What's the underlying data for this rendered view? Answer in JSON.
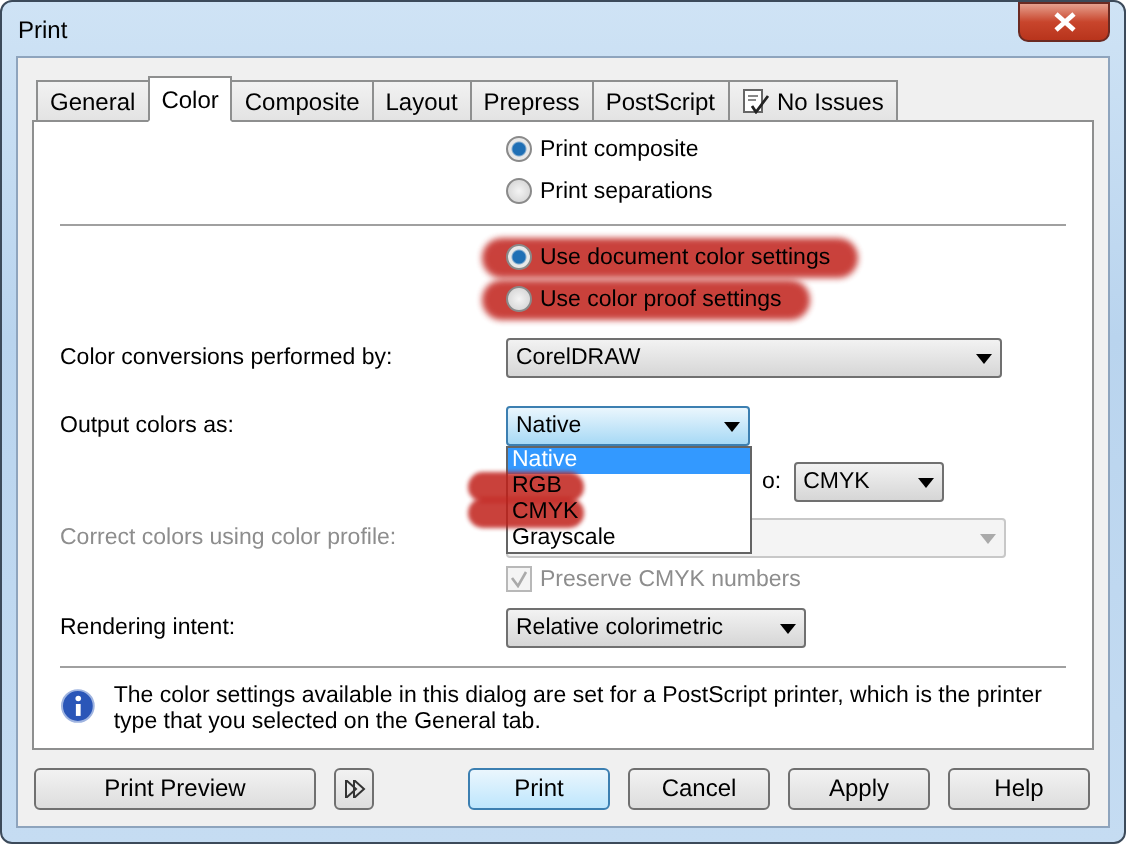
{
  "window": {
    "title": "Print"
  },
  "tabs": [
    {
      "label": "General",
      "selected": false,
      "kind": "plain"
    },
    {
      "label": "Color",
      "selected": true,
      "kind": "plain"
    },
    {
      "label": "Composite",
      "selected": false,
      "kind": "plain"
    },
    {
      "label": "Layout",
      "selected": false,
      "kind": "plain"
    },
    {
      "label": "Prepress",
      "selected": false,
      "kind": "plain"
    },
    {
      "label": "PostScript",
      "selected": false,
      "kind": "plain"
    },
    {
      "label": "No Issues",
      "selected": false,
      "kind": "status"
    }
  ],
  "print_mode": [
    {
      "label": "Print composite",
      "selected": true,
      "highlighted": false
    },
    {
      "label": "Print separations",
      "selected": false,
      "highlighted": false
    }
  ],
  "color_settings": [
    {
      "label": "Use document color settings",
      "selected": true,
      "highlighted": true
    },
    {
      "label": "Use color proof settings",
      "selected": false,
      "highlighted": true
    }
  ],
  "conversions": {
    "label": "Color conversions performed by:",
    "value": "CorelDRAW"
  },
  "output_colors": {
    "label": "Output colors as:",
    "value": "Native",
    "options": [
      {
        "label": "Native",
        "selected": true,
        "highlighted": false
      },
      {
        "label": "RGB",
        "selected": false,
        "highlighted": true
      },
      {
        "label": "CMYK",
        "selected": false,
        "highlighted": true
      },
      {
        "label": "Grayscale",
        "selected": false,
        "highlighted": false
      }
    ]
  },
  "convert_to": {
    "label": "o:",
    "value": "CMYK"
  },
  "profile": {
    "label": "Correct colors using color profile:",
    "disabled": true
  },
  "preserve": {
    "label": "Preserve CMYK numbers",
    "checked": true,
    "disabled": true
  },
  "rendering": {
    "label": "Rendering intent:",
    "value": "Relative colorimetric"
  },
  "info": "The color settings available in this dialog are set for a PostScript printer, which is the printer type that you selected on the General tab.",
  "buttons": [
    {
      "label": "Print Preview",
      "kind": "wide"
    },
    {
      "kind": "expand"
    },
    {
      "label": "Print",
      "kind": "default"
    },
    {
      "label": "Cancel",
      "kind": "normal"
    },
    {
      "label": "Apply",
      "kind": "normal"
    },
    {
      "label": "Help",
      "kind": "normal"
    }
  ]
}
